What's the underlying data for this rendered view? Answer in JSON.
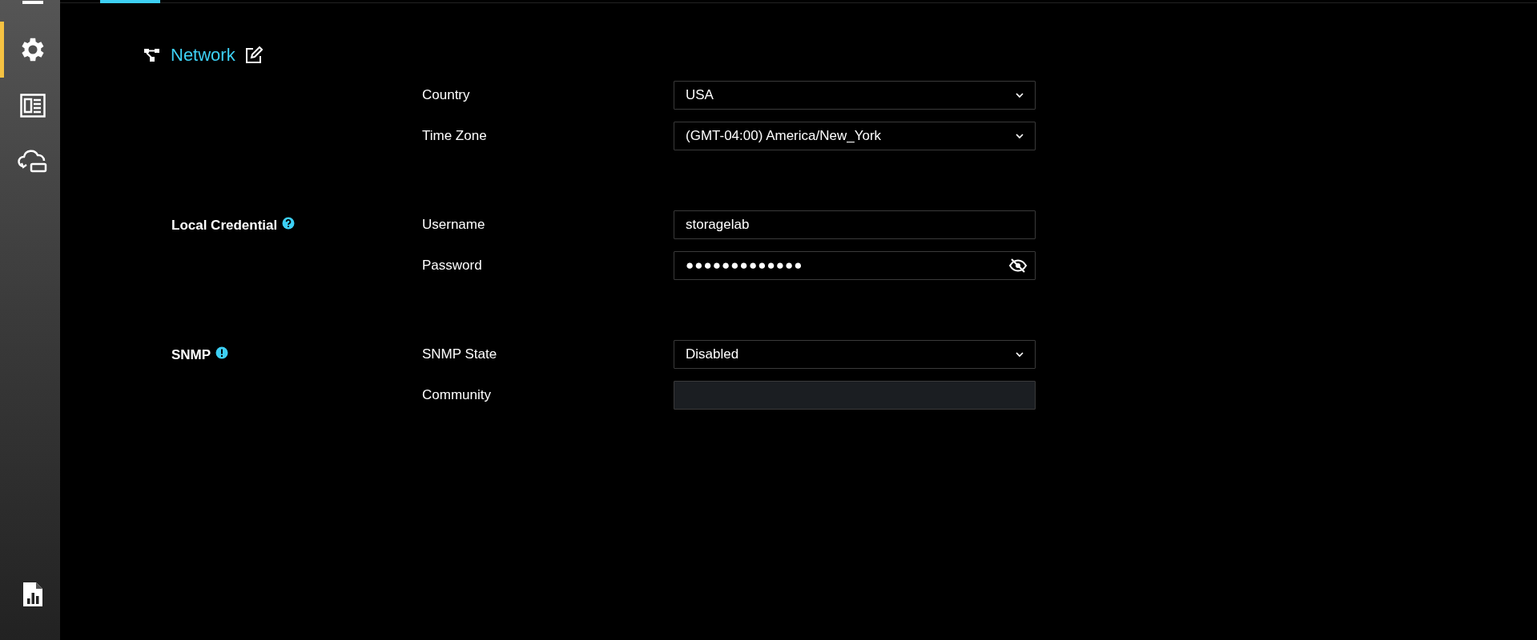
{
  "sidebar": {
    "items": [
      {
        "kind": "partial",
        "selected": false
      },
      {
        "kind": "settings",
        "selected": true
      },
      {
        "kind": "panel",
        "selected": false
      },
      {
        "kind": "cloud",
        "selected": false
      }
    ],
    "bottom_items": [
      {
        "kind": "report",
        "selected": false
      }
    ]
  },
  "page": {
    "title": "Network"
  },
  "sections": [
    {
      "fields": [
        {
          "label": "Country",
          "kind": "select",
          "value": "USA"
        },
        {
          "label": "Time Zone",
          "kind": "select",
          "value": "(GMT-04:00) America/New_York"
        }
      ]
    },
    {
      "label": "Local Credential",
      "hint": {
        "kind": "help"
      },
      "fields": [
        {
          "label": "Username",
          "kind": "text",
          "value": "storagelab"
        },
        {
          "label": "Password",
          "kind": "password",
          "value": "●●●●●●●●●●●●●"
        }
      ]
    },
    {
      "label": "SNMP",
      "hint": {
        "kind": "info"
      },
      "fields": [
        {
          "label": "SNMP State",
          "kind": "select",
          "value": "Disabled"
        },
        {
          "label": "Community",
          "kind": "text",
          "disabled": true
        }
      ]
    }
  ]
}
